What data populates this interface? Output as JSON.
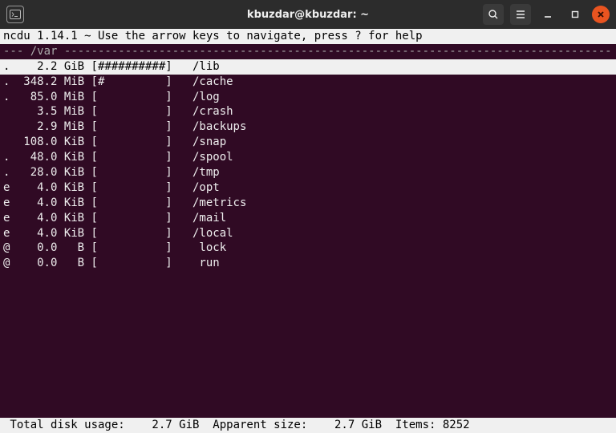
{
  "window": {
    "title": "kbuzdar@kbuzdar: ~"
  },
  "ncdu": {
    "header": "ncdu 1.14.1 ~ Use the arrow keys to navigate, press ? for help",
    "path": "/var",
    "items": [
      {
        "selected": true,
        "flag": ".",
        "size": "2.2 GiB",
        "bar": "[##########]",
        "name": "/lib"
      },
      {
        "selected": false,
        "flag": ".",
        "size": "348.2 MiB",
        "bar": "[#         ]",
        "name": "/cache"
      },
      {
        "selected": false,
        "flag": ".",
        "size": "85.0 MiB",
        "bar": "[          ]",
        "name": "/log"
      },
      {
        "selected": false,
        "flag": " ",
        "size": "3.5 MiB",
        "bar": "[          ]",
        "name": "/crash"
      },
      {
        "selected": false,
        "flag": " ",
        "size": "2.9 MiB",
        "bar": "[          ]",
        "name": "/backups"
      },
      {
        "selected": false,
        "flag": " ",
        "size": "108.0 KiB",
        "bar": "[          ]",
        "name": "/snap"
      },
      {
        "selected": false,
        "flag": ".",
        "size": "48.0 KiB",
        "bar": "[          ]",
        "name": "/spool"
      },
      {
        "selected": false,
        "flag": ".",
        "size": "28.0 KiB",
        "bar": "[          ]",
        "name": "/tmp"
      },
      {
        "selected": false,
        "flag": "e",
        "size": "4.0 KiB",
        "bar": "[          ]",
        "name": "/opt"
      },
      {
        "selected": false,
        "flag": "e",
        "size": "4.0 KiB",
        "bar": "[          ]",
        "name": "/metrics"
      },
      {
        "selected": false,
        "flag": "e",
        "size": "4.0 KiB",
        "bar": "[          ]",
        "name": "/mail"
      },
      {
        "selected": false,
        "flag": "e",
        "size": "4.0 KiB",
        "bar": "[          ]",
        "name": "/local"
      },
      {
        "selected": false,
        "flag": "@",
        "size": "0.0   B",
        "bar": "[          ]",
        "name": " lock"
      },
      {
        "selected": false,
        "flag": "@",
        "size": "0.0   B",
        "bar": "[          ]",
        "name": " run"
      }
    ],
    "footer": {
      "total_label": " Total disk usage:",
      "total": "2.7 GiB",
      "apparent_label": "Apparent size:",
      "apparent": "2.7 GiB",
      "items_label": "Items:",
      "items": "8252"
    }
  }
}
